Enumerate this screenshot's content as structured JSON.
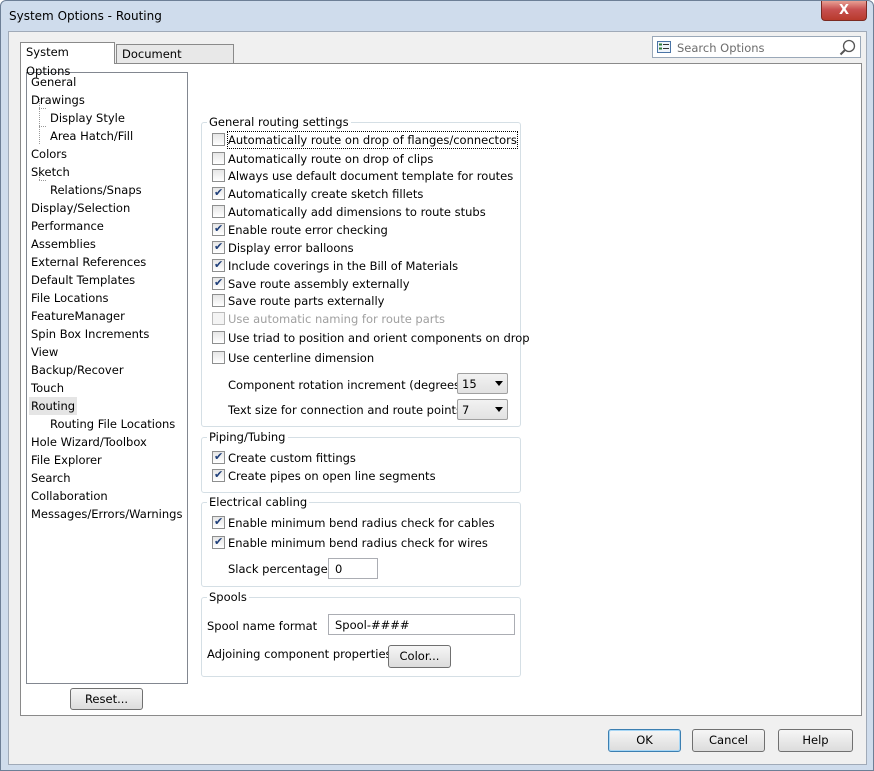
{
  "window": {
    "title": "System Options - Routing",
    "close_glyph": "X"
  },
  "tabs": [
    {
      "label": "System Options"
    },
    {
      "label": "Document Properties"
    }
  ],
  "search": {
    "placeholder": "Search Options",
    "icon": "list-icon",
    "button_icon": "magnifier-icon"
  },
  "tree": [
    {
      "label": "General",
      "level": 0
    },
    {
      "label": "Drawings",
      "level": 0
    },
    {
      "label": "Display Style",
      "level": 1
    },
    {
      "label": "Area Hatch/Fill",
      "level": 1
    },
    {
      "label": "Colors",
      "level": 0
    },
    {
      "label": "Sketch",
      "level": 0
    },
    {
      "label": "Relations/Snaps",
      "level": 1
    },
    {
      "label": "Display/Selection",
      "level": 0
    },
    {
      "label": "Performance",
      "level": 0
    },
    {
      "label": "Assemblies",
      "level": 0
    },
    {
      "label": "External References",
      "level": 0
    },
    {
      "label": "Default Templates",
      "level": 0
    },
    {
      "label": "File Locations",
      "level": 0
    },
    {
      "label": "FeatureManager",
      "level": 0
    },
    {
      "label": "Spin Box Increments",
      "level": 0
    },
    {
      "label": "View",
      "level": 0
    },
    {
      "label": "Backup/Recover",
      "level": 0
    },
    {
      "label": "Touch",
      "level": 0
    },
    {
      "label": "Routing",
      "level": 0,
      "selected": true
    },
    {
      "label": "Routing File Locations",
      "level": 1
    },
    {
      "label": "Hole Wizard/Toolbox",
      "level": 0
    },
    {
      "label": "File Explorer",
      "level": 0
    },
    {
      "label": "Search",
      "level": 0
    },
    {
      "label": "Collaboration",
      "level": 0
    },
    {
      "label": "Messages/Errors/Warnings",
      "level": 0
    }
  ],
  "general": {
    "title": "General routing settings",
    "options": [
      {
        "label": "Automatically route on drop of flanges/connectors",
        "checked": false
      },
      {
        "label": "Automatically route on drop of clips",
        "checked": false
      },
      {
        "label": "Always use default document template for routes",
        "checked": false
      },
      {
        "label": "Automatically create sketch fillets",
        "checked": true
      },
      {
        "label": "Automatically add dimensions to route stubs",
        "checked": false
      },
      {
        "label": "Enable route error checking",
        "checked": true
      },
      {
        "label": "Display error balloons",
        "checked": true
      },
      {
        "label": "Include coverings in the Bill of Materials",
        "checked": true
      },
      {
        "label": "Save route assembly externally",
        "checked": true
      },
      {
        "label": "Save route parts externally",
        "checked": false
      },
      {
        "label": "Use automatic naming for route parts",
        "checked": false,
        "disabled": true
      },
      {
        "label": "Use triad to position and orient components on drop",
        "checked": false
      },
      {
        "label": "Use centerline dimension",
        "checked": false
      }
    ],
    "rotation_label": "Component rotation increment (degrees):",
    "rotation_value": "15",
    "textsize_label": "Text size for connection and route points:",
    "textsize_value": "7"
  },
  "piping": {
    "title": "Piping/Tubing",
    "options": [
      {
        "label": "Create custom fittings",
        "checked": true
      },
      {
        "label": "Create pipes on open line segments",
        "checked": true
      }
    ]
  },
  "electrical": {
    "title": "Electrical cabling",
    "options": [
      {
        "label": "Enable minimum bend radius check for cables",
        "checked": true
      },
      {
        "label": "Enable minimum bend radius check for wires",
        "checked": true
      }
    ],
    "slack_label": "Slack percentage:",
    "slack_value": "0"
  },
  "spools": {
    "title": "Spools",
    "name_format_label": "Spool name format",
    "name_format_value": "Spool-####",
    "adjoining_label": "Adjoining component properties",
    "color_button": "Color..."
  },
  "reset_button": "Reset...",
  "footer": {
    "ok": "OK",
    "cancel": "Cancel",
    "help": "Help"
  }
}
